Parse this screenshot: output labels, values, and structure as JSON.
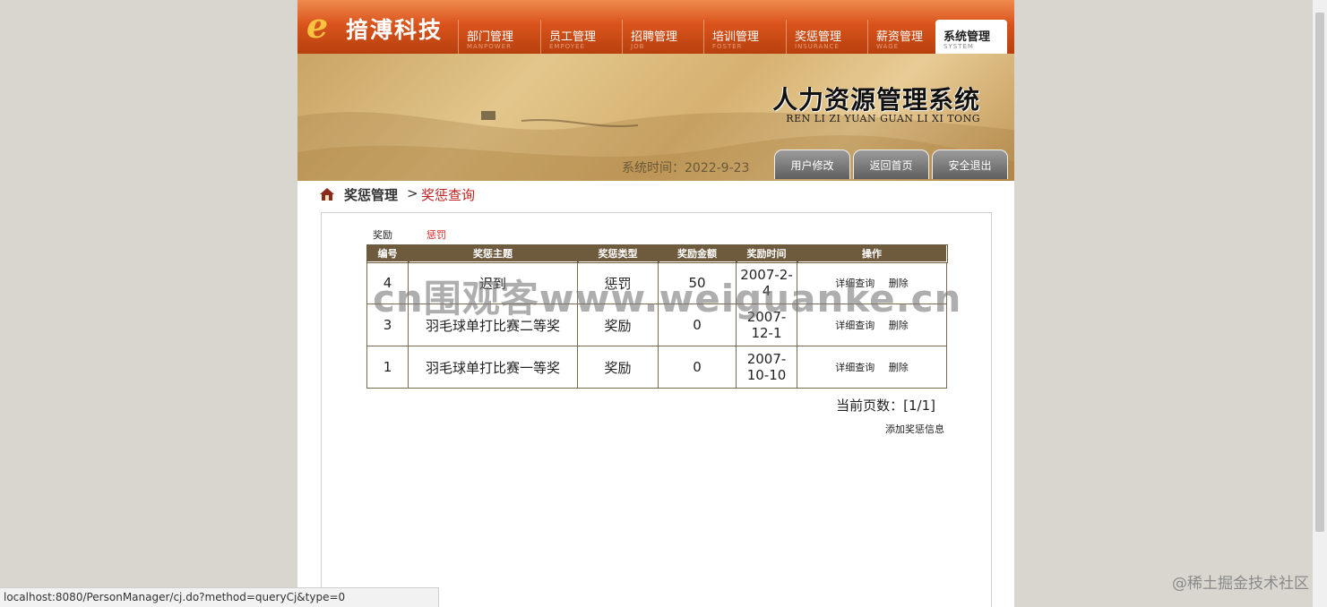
{
  "brand": {
    "mark": "e",
    "name": "揞溥科技"
  },
  "nav": [
    {
      "cn": "部门管理",
      "en": "MANPOWER",
      "active": false
    },
    {
      "cn": "员工管理",
      "en": "EMPOYEE",
      "active": false
    },
    {
      "cn": "招聘管理",
      "en": "JOB",
      "active": false
    },
    {
      "cn": "培训管理",
      "en": "FOSTER",
      "active": false
    },
    {
      "cn": "奖惩管理",
      "en": "INSURANCE",
      "active": false
    },
    {
      "cn": "薪资管理",
      "en": "WAGE",
      "active": false
    },
    {
      "cn": "系统管理",
      "en": "SYSTEM",
      "active": true
    }
  ],
  "banner": {
    "title": "人力资源管理系统",
    "subtitle": "REN LI ZI YUAN GUAN LI XI TONG",
    "system_time": "系统时间：2022-9-23",
    "buttons": [
      "用户修改",
      "返回首页",
      "安全退出"
    ]
  },
  "breadcrumb": {
    "section": "奖惩管理",
    "separator": ">",
    "page": "奖惩查询"
  },
  "filters": {
    "reward": "奖励",
    "punish": "惩罚"
  },
  "table": {
    "headers": [
      "编号",
      "奖惩主题",
      "奖惩类型",
      "奖励金额",
      "奖励时间",
      "操作"
    ],
    "rows": [
      {
        "id": "4",
        "subject": "迟到",
        "type": "惩罚",
        "amount": "50",
        "time": "2007-2-4"
      },
      {
        "id": "3",
        "subject": "羽毛球单打比赛二等奖",
        "type": "奖励",
        "amount": "0",
        "time": "2007-12-1"
      },
      {
        "id": "1",
        "subject": "羽毛球单打比赛一等奖",
        "type": "奖励",
        "amount": "0",
        "time": "2007-10-10"
      }
    ],
    "op_detail": "详细查询",
    "op_delete": "删除"
  },
  "page_info": "当前页数：[1/1]",
  "add_link": "添加奖惩信息",
  "watermark": "cn围观客www.weiguanke.cn",
  "corner_watermark": "@稀土掘金技术社区",
  "status_url": "localhost:8080/PersonManager/cj.do?method=queryCj&type=0",
  "colors": {
    "nav_orange": "#d9541c",
    "table_header": "#6e5a3d",
    "link_red": "#c0201e"
  }
}
